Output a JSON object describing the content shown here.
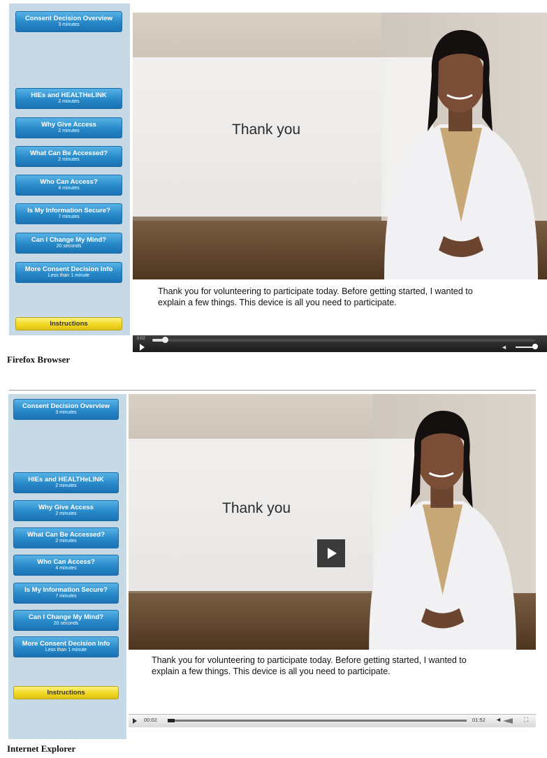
{
  "nav": [
    {
      "title": "Consent Decision Overview",
      "duration": "3 minutes"
    },
    {
      "title": "HIEs and HEALTHeLINK",
      "duration": "2 minutes"
    },
    {
      "title": "Why Give Access",
      "duration": "2 minutes"
    },
    {
      "title": "What Can Be Accessed?",
      "duration": "2 minutes"
    },
    {
      "title": "Who Can Access?",
      "duration": "4 minutes"
    },
    {
      "title": "Is My Information Secure?",
      "duration": "7 minutes"
    },
    {
      "title": "Can I Change My Mind?",
      "duration": "20 seconds"
    },
    {
      "title": "More Consent Decision Info",
      "duration": "Less than 1 minute"
    }
  ],
  "instructions_label": "Instructions",
  "overlay_text": "Thank you",
  "caption_line1": "Thank you for volunteering to participate today.  Before getting started, I wanted to",
  "caption_line2": "explain a few things.  This device is all you need to participate.",
  "firefox_label": "Firefox  Browser",
  "ie_label": "Internet Explorer",
  "ff_controls": {
    "time": "0:02"
  },
  "ie_controls": {
    "time_current": "00:02",
    "time_total": "01:52"
  },
  "colors": {
    "nav_blue": "#2788c8",
    "instr_yellow": "#f1d61f",
    "sidebar_bg": "#c8d9e6"
  }
}
